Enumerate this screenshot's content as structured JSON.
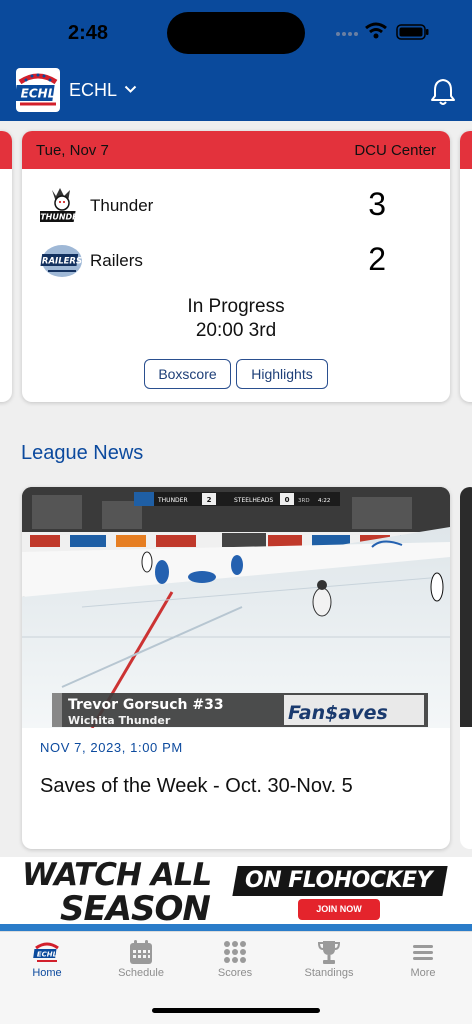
{
  "status_bar": {
    "time": "2:48"
  },
  "header": {
    "league": "ECHL",
    "logo_text": "ECHL"
  },
  "game": {
    "date": "Tue, Nov 7",
    "venue": "DCU Center",
    "home": {
      "name": "Thunder",
      "score": "3"
    },
    "away": {
      "name": "Railers",
      "score": "2"
    },
    "status": "In Progress",
    "clock": "20:00 3rd",
    "boxscore_label": "Boxscore",
    "highlights_label": "Highlights"
  },
  "news": {
    "section_title": "League News",
    "items": [
      {
        "date": "NOV 7, 2023, 1:00 PM",
        "title": "Saves of the Week - Oct. 30-Nov. 5",
        "image": {
          "scorebug": {
            "team1": "THUNDER",
            "score1": "2",
            "team2": "STEELHEADS",
            "score2": "0",
            "period": "3RD",
            "clock": "4:22"
          },
          "lower_third_name": "Trevor Gorsuch #33",
          "lower_third_team": "Wichita Thunder",
          "sponsor": "Fan$aves"
        }
      }
    ]
  },
  "ad": {
    "line1": "WATCH ALL",
    "line2": "SEASON",
    "brand": "ON FLOHOCKEY",
    "cta": "JOIN NOW"
  },
  "tabs": [
    {
      "label": "Home",
      "icon": "home-logo-icon",
      "active": true
    },
    {
      "label": "Schedule",
      "icon": "calendar-icon",
      "active": false
    },
    {
      "label": "Scores",
      "icon": "grid-dots-icon",
      "active": false
    },
    {
      "label": "Standings",
      "icon": "trophy-icon",
      "active": false
    },
    {
      "label": "More",
      "icon": "menu-icon",
      "active": false
    }
  ],
  "colors": {
    "brand_blue": "#0a4a9c",
    "accent_red": "#e3323c",
    "link_blue": "#0c4a9e"
  }
}
